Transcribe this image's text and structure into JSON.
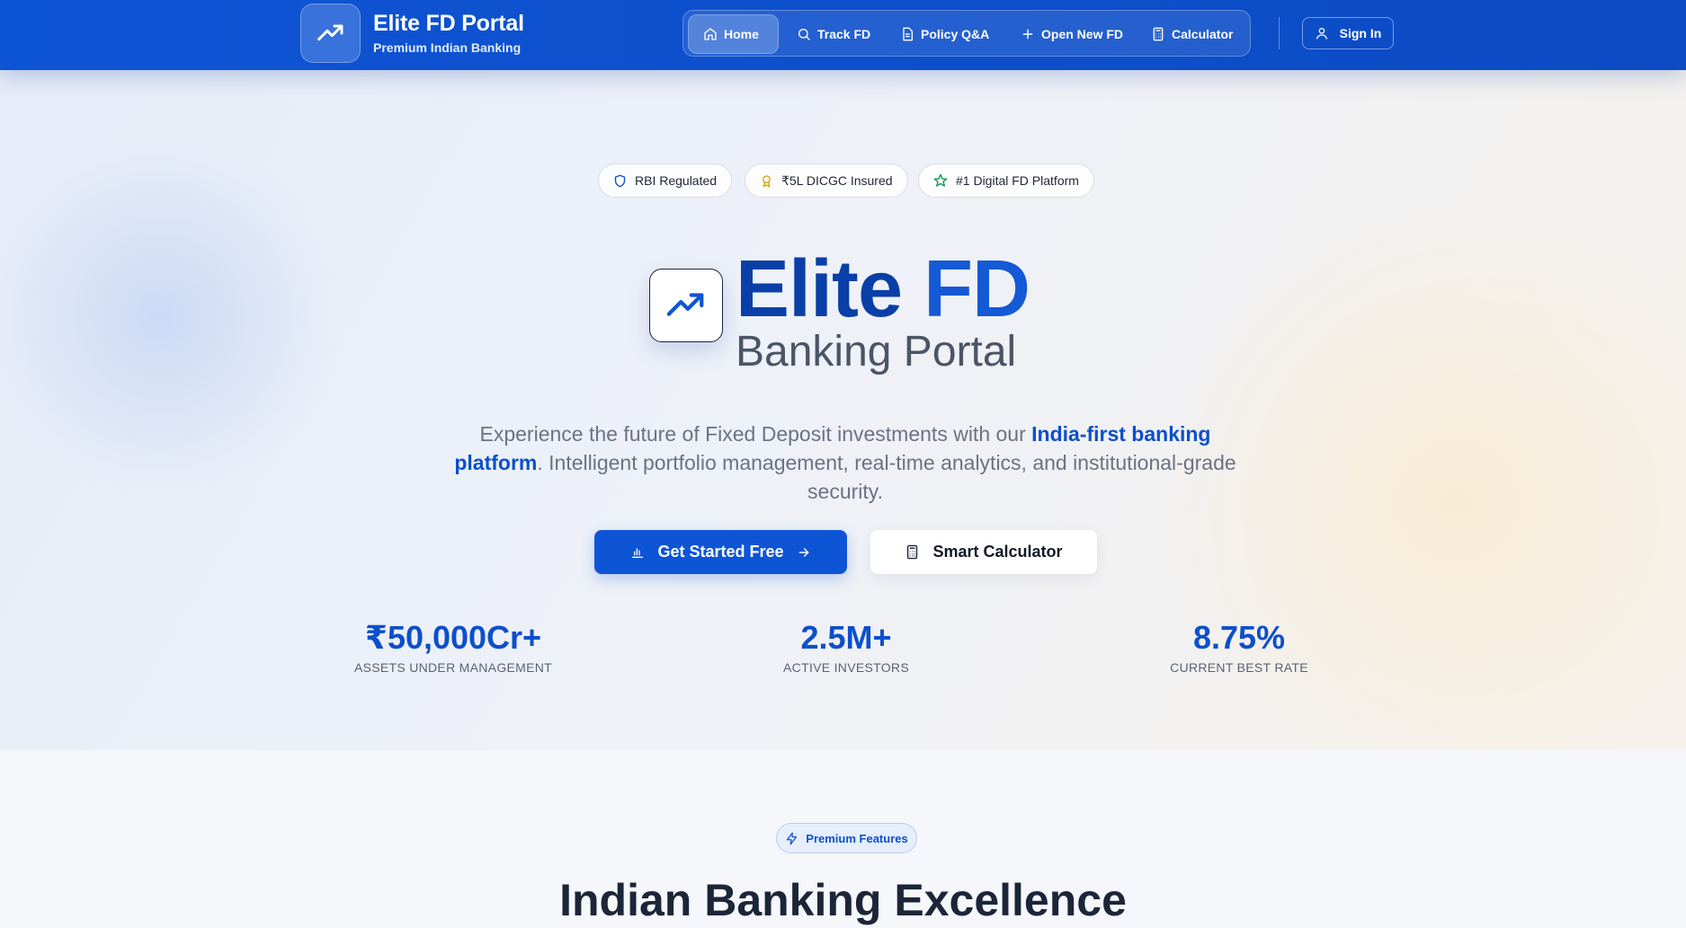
{
  "header": {
    "brand_title": "Elite FD Portal",
    "brand_subtitle": "Premium Indian Banking",
    "nav": [
      {
        "label": "Home",
        "icon": "home-icon",
        "active": true
      },
      {
        "label": "Track FD",
        "icon": "search-icon",
        "active": false
      },
      {
        "label": "Policy Q&A",
        "icon": "document-icon",
        "active": false
      },
      {
        "label": "Open New FD",
        "icon": "plus-icon",
        "active": false
      },
      {
        "label": "Calculator",
        "icon": "calculator-icon",
        "active": false
      }
    ],
    "sign_in_label": "Sign In"
  },
  "hero": {
    "badges": [
      {
        "label": "RBI Regulated",
        "icon": "shield-icon"
      },
      {
        "label": "₹5L DICGC Insured",
        "icon": "award-icon"
      },
      {
        "label": "#1 Digital FD Platform",
        "icon": "star-icon"
      }
    ],
    "title_main": "Elite ",
    "title_accent": "FD",
    "subtitle": "Banking Portal",
    "description_before": "Experience the future of Fixed Deposit investments with our ",
    "description_highlight": "India-first banking platform",
    "description_after": ". Intelligent portfolio management, real-time analytics, and institutional-grade security.",
    "primary_cta": "Get Started Free",
    "secondary_cta": "Smart Calculator",
    "stats": [
      {
        "value": "₹50,000Cr+",
        "label": "ASSETS UNDER MANAGEMENT"
      },
      {
        "value": "2.5M+",
        "label": "ACTIVE INVESTORS"
      },
      {
        "value": "8.75%",
        "label": "CURRENT BEST RATE"
      }
    ]
  },
  "features": {
    "pill_label": "Premium Features",
    "title": "Indian Banking Excellence"
  },
  "colors": {
    "brand_blue": "#0e55d6",
    "header_bg": "#0d4fcc",
    "accent_text": "#0d4fcc",
    "badge_star": "#1f9d55",
    "badge_award": "#d4a514"
  }
}
